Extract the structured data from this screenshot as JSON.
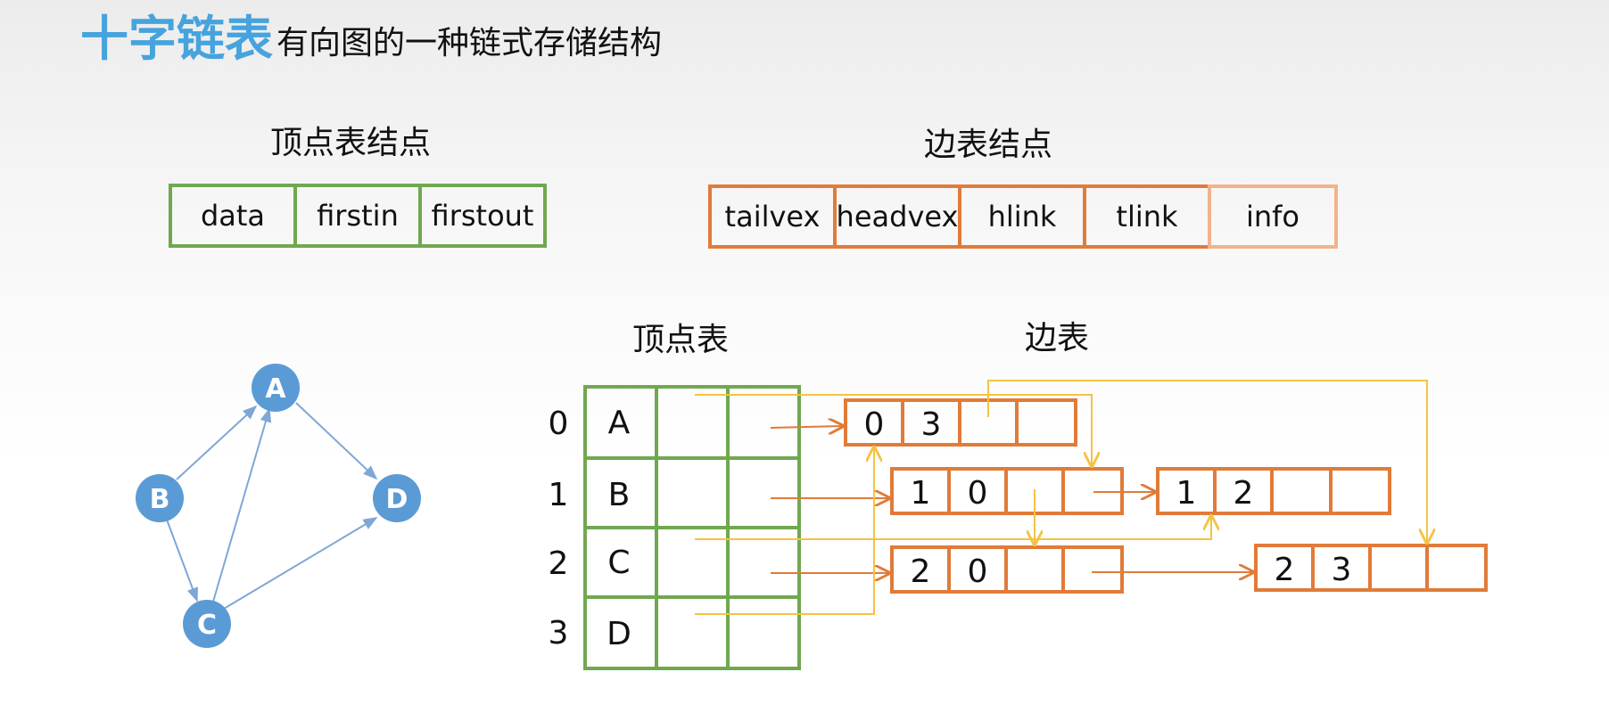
{
  "title": {
    "main": "十字链表",
    "sub": "有向图的一种链式存储结构"
  },
  "vertex_node": {
    "heading": "顶点表结点",
    "fields": [
      "data",
      "firstin",
      "firstout"
    ]
  },
  "edge_node": {
    "heading": "边表结点",
    "fields": [
      "tailvex",
      "headvex",
      "hlink",
      "tlink",
      "info"
    ]
  },
  "graph": {
    "vertices": [
      "A",
      "B",
      "C",
      "D"
    ],
    "edges": [
      [
        "B",
        "A"
      ],
      [
        "C",
        "A"
      ],
      [
        "A",
        "D"
      ],
      [
        "B",
        "C"
      ],
      [
        "C",
        "D"
      ]
    ]
  },
  "vertex_table": {
    "heading": "顶点表",
    "rows": [
      {
        "index": "0",
        "data": "A"
      },
      {
        "index": "1",
        "data": "B"
      },
      {
        "index": "2",
        "data": "C"
      },
      {
        "index": "3",
        "data": "D"
      }
    ]
  },
  "edge_table": {
    "heading": "边表",
    "nodes": [
      {
        "tail": "0",
        "head": "3"
      },
      {
        "tail": "1",
        "head": "0"
      },
      {
        "tail": "1",
        "head": "2"
      },
      {
        "tail": "2",
        "head": "0"
      },
      {
        "tail": "2",
        "head": "3"
      }
    ]
  },
  "colors": {
    "accent": "#46a3dd",
    "vertex_border": "#70a84f",
    "edge_border": "#e07b39",
    "info_border": "#f2b28a",
    "tail_link": "#e07b39",
    "head_link": "#f5c242",
    "graph_node": "#5b9bd5",
    "graph_edge": "#7ea7d6"
  }
}
